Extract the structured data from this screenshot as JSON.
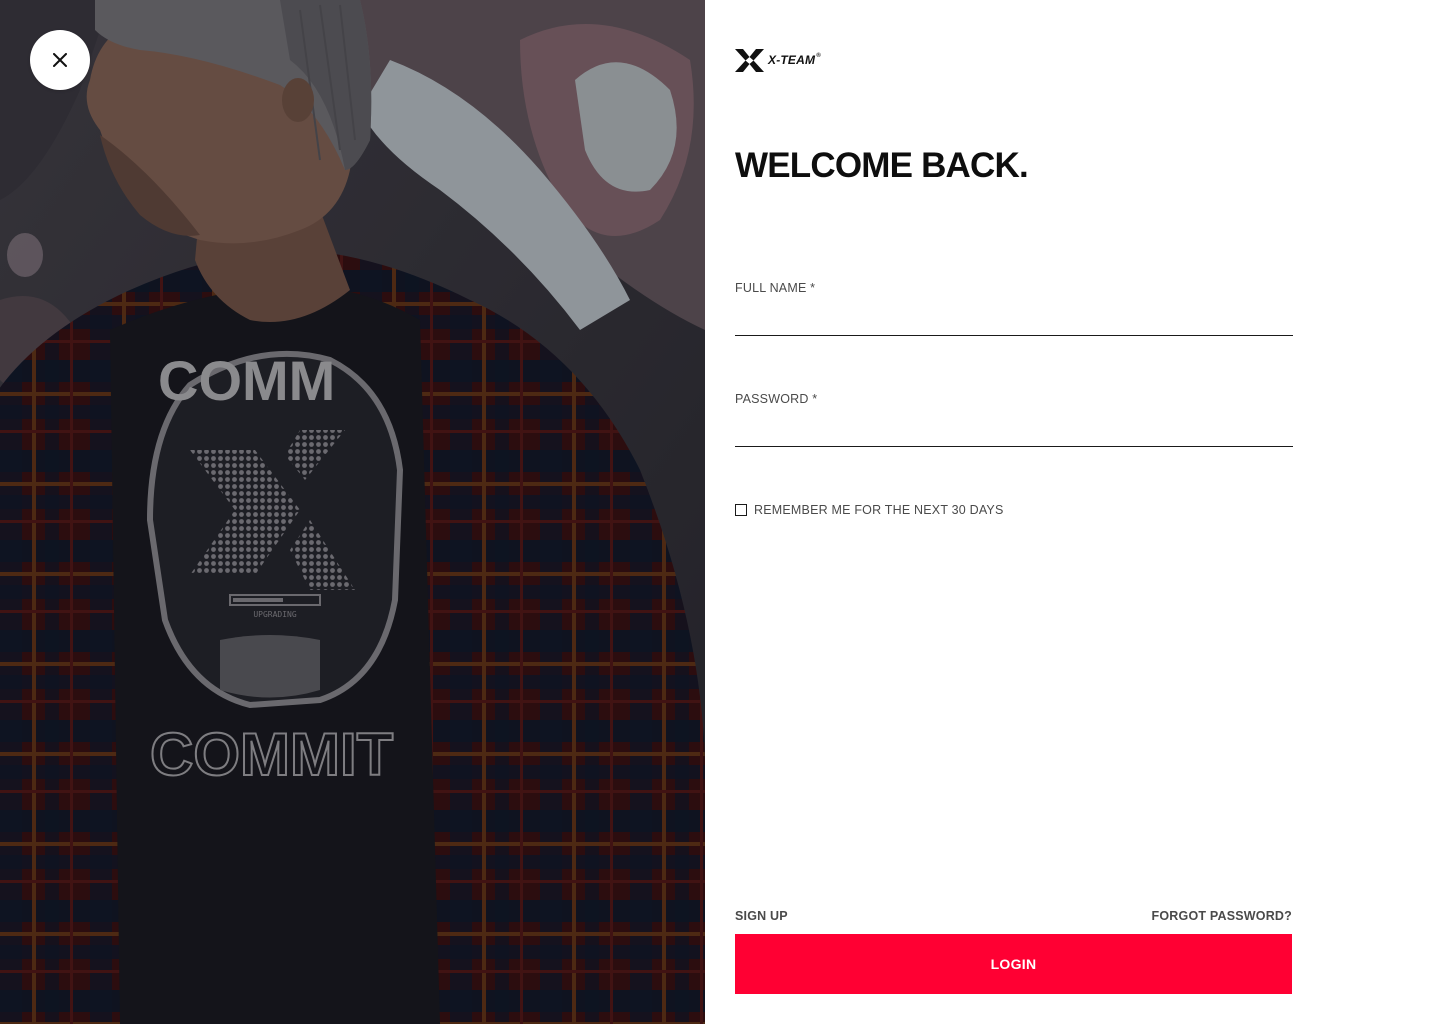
{
  "brand": {
    "name": "X-TEAM",
    "reg_mark": "®",
    "accent_color": "#ff0033"
  },
  "close_button": {
    "icon": "close-icon"
  },
  "heading": "WELCOME BACK.",
  "form": {
    "full_name": {
      "label": "FULL NAME *",
      "value": "",
      "placeholder": ""
    },
    "password": {
      "label": "PASSWORD *",
      "value": "",
      "placeholder": ""
    },
    "remember": {
      "label": "REMEMBER ME FOR THE NEXT 30 DAYS",
      "checked": false
    }
  },
  "links": {
    "sign_up": "SIGN UP",
    "forgot_password": "FORGOT PASSWORD?"
  },
  "login_button": "LOGIN",
  "photo": {
    "shirt_text_top": "COMM",
    "shirt_text_bottom": "COMMIT",
    "progress_label": "UPGRADING"
  }
}
